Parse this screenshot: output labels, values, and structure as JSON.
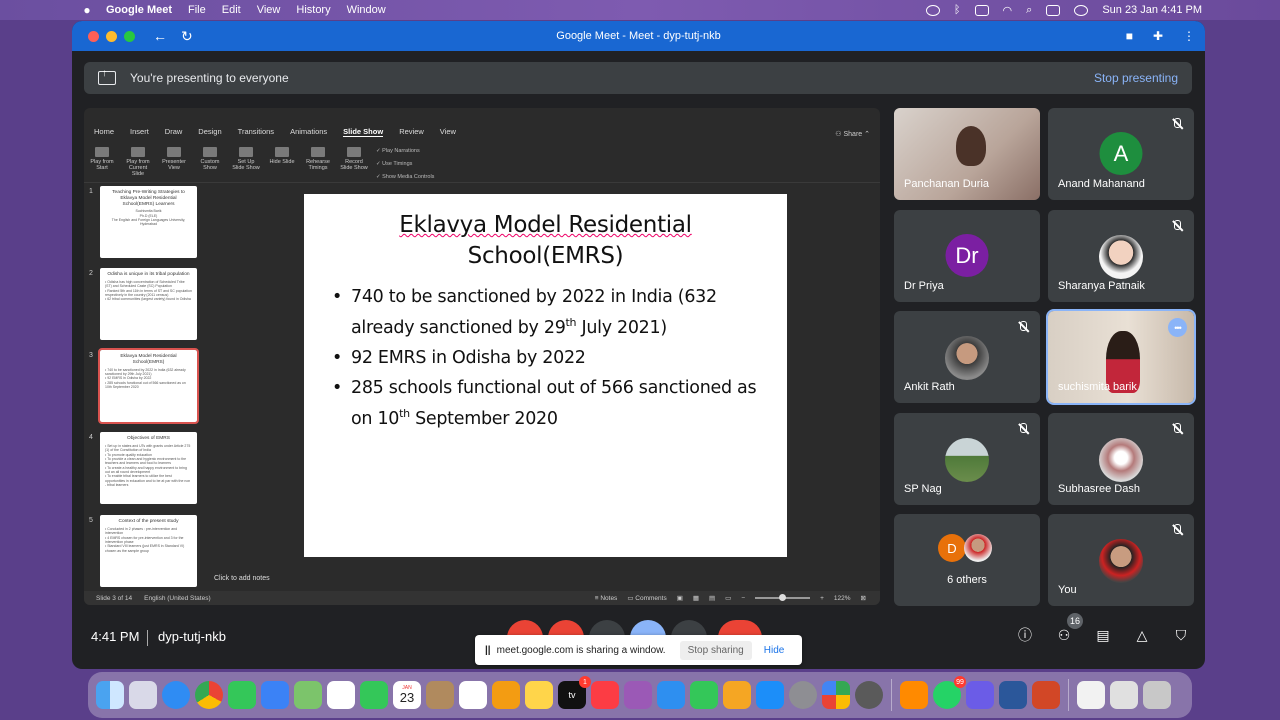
{
  "menubar": {
    "app": "Google Meet",
    "items": [
      "File",
      "Edit",
      "View",
      "History",
      "Window"
    ],
    "datetime": "Sun 23 Jan  4:41 PM"
  },
  "window": {
    "title": "Google Meet - Meet - dyp-tutj-nkb"
  },
  "banner": {
    "text": "You're presenting to everyone",
    "stop": "Stop presenting"
  },
  "ppt": {
    "tabs": [
      "Home",
      "Insert",
      "Draw",
      "Design",
      "Transitions",
      "Animations",
      "Slide Show",
      "Review",
      "View"
    ],
    "active_tab": "Slide Show",
    "share": "Share",
    "ribbon": [
      "Play from Start",
      "Play from Current Slide",
      "Presenter View",
      "Custom Show",
      "Set Up Slide Show",
      "Hide Slide",
      "Rehearse Timings",
      "Record Slide Show"
    ],
    "checks": [
      "Play Narrations",
      "Use Timings",
      "Show Media Controls"
    ],
    "thumbs": [
      {
        "num": "1",
        "title": "Teaching Pre-Writing Strategies to Eklavya Model Residential School(EMRS) Learners",
        "body": "Suchismita Barik\nPh.D (ELE)\nThe English and Foreign Languages University, Hyderabad"
      },
      {
        "num": "2",
        "title": "Odisha is unique in its tribal population",
        "body": "• Odisha has high concentration of Scheduled Tribe (ST) and Scheduled Caste (SC) Population\n• Ranked 5th and 11th in terms of ST and SC population respectively in the country (2011 census)\n• 62 tribal communities (largest variety) found in Odisha"
      },
      {
        "num": "3",
        "title": "Eklavya Model Residential School(EMRS)",
        "body": "• 740 to be sanctioned by 2022 in India (632 already sanctioned by 29th July 2021)\n• 92 EMRS in Odisha by 2022\n• 285 schools functional out of 566 sanctioned as on 10th September 2020"
      },
      {
        "num": "4",
        "title": "Objectives of EMRS",
        "body": "• Set up in states and UTs with grants under Article 275 (1) of the Constitution of India\n• To promote quality education\n• To provide a clean and hygienic environment to the teachers and learners and food to learners\n• To create a healthy and happy environment to bring out an all round development\n• To enable tribal learners to utilize the best opportunities in education and to be at par with the non - tribal learners"
      },
      {
        "num": "5",
        "title": "Context of the present study",
        "body": "• Conducted in 2 phases : pre-intervention and intervention\n• 4 EMRS chosen for pre-intervention and 3 for the intervention phase\n• Standard VIII learners (just EMRS in Standard VI) chosen as the sample group"
      }
    ],
    "slide": {
      "title_line1": "Eklavya Model Residential",
      "title_line2": "School(EMRS)",
      "b1_a": "740 to be sanctioned by 2022 in India (632 already sanctioned by 29",
      "b1_sup": "th",
      "b1_b": " July 2021)",
      "b2": "92 EMRS in Odisha by 2022",
      "b3_a": "285 schools functional out of 566 sanctioned as on 10",
      "b3_sup": "th",
      "b3_b": " September 2020"
    },
    "notes": "Click to add notes",
    "status_left": "Slide 3 of 14",
    "status_lang": "English (United States)",
    "status_notes": "Notes",
    "status_comments": "Comments",
    "zoom": "122%"
  },
  "participants": [
    {
      "name": "Panchanan Duria",
      "type": "video"
    },
    {
      "name": "Anand Mahanand",
      "letter": "A",
      "color": "#1e8e3e",
      "muted": true
    },
    {
      "name": "Dr Priya",
      "letter": "Dr",
      "color": "#7b1fa2"
    },
    {
      "name": "Sharanya Patnaik",
      "type": "photo",
      "muted": true
    },
    {
      "name": "Ankit Rath",
      "type": "photo",
      "muted": true
    },
    {
      "name": "suchismita barik",
      "type": "video",
      "active": true
    },
    {
      "name": "SP Nag",
      "type": "photo",
      "muted": true
    },
    {
      "name": "Subhasree Dash",
      "type": "photo",
      "muted": true
    },
    {
      "name": "6 others",
      "letter": "D",
      "color": "#e8710a"
    },
    {
      "name": "You",
      "type": "photo",
      "muted": true
    }
  ],
  "bottom": {
    "time": "4:41 PM",
    "code": "dyp-tutj-nkb",
    "people_count": "16"
  },
  "share_notice": {
    "msg": "meet.google.com is sharing a window.",
    "stop": "Stop sharing",
    "hide": "Hide"
  },
  "dock": {
    "calendar_month": "JAN",
    "calendar_day": "23",
    "appletv_badge": "1",
    "whatsapp_badge": "99",
    "appletv_label": "tv"
  }
}
